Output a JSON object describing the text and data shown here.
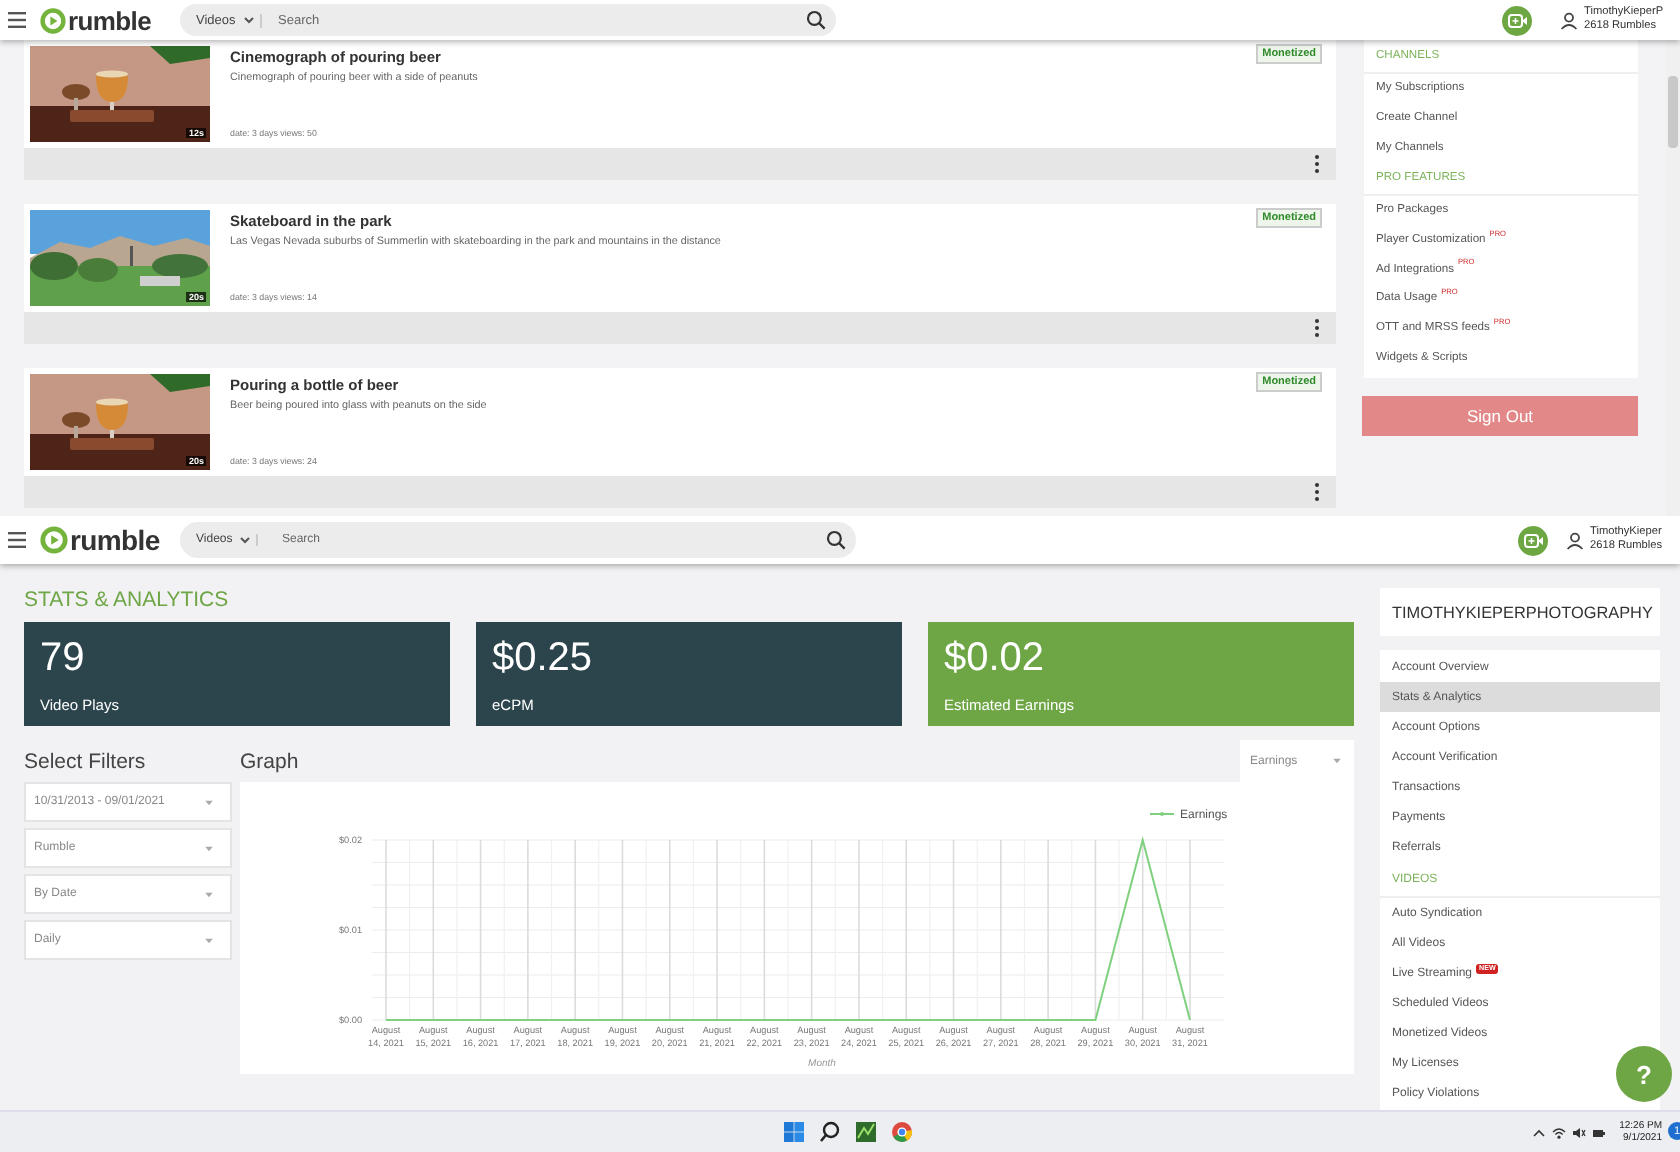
{
  "top_screen": {
    "header": {
      "logo": "rumble",
      "search_scope": "Videos",
      "search": {
        "placeholder": "Search"
      },
      "user": {
        "name": "TimothyKieperP",
        "rumbles": "2618 Rumbles"
      }
    },
    "videos": [
      {
        "title": "Cinemograph of pouring beer",
        "description": "Cinemograph of pouring beer with a side of peanuts",
        "meta": "date: 3 days views: 50",
        "duration": "12s",
        "status": "Monetized"
      },
      {
        "title": "Skateboard in the park",
        "description": "Las Vegas Nevada suburbs of Summerlin with skateboarding in the park and mountains in the distance",
        "meta": "date: 3 days views: 14",
        "duration": "20s",
        "status": "Monetized"
      },
      {
        "title": "Pouring a bottle of beer",
        "description": "Beer being poured into glass with peanuts on the side",
        "meta": "date: 3 days views: 24",
        "duration": "20s",
        "status": "Monetized"
      }
    ],
    "sidebar": [
      {
        "heading": "CHANNELS",
        "items": [
          {
            "label": "My Subscriptions"
          },
          {
            "label": "Create Channel"
          },
          {
            "label": "My Channels"
          }
        ]
      },
      {
        "heading": "PRO FEATURES",
        "items": [
          {
            "label": "Pro Packages"
          },
          {
            "label": "Player Customization",
            "tag": {
              "text": "PRO",
              "kind": "pro"
            }
          },
          {
            "label": "Ad Integrations",
            "tag": {
              "text": "PRO",
              "kind": "pro"
            }
          },
          {
            "label": "Data Usage",
            "tag": {
              "text": "PRO",
              "kind": "pro"
            }
          },
          {
            "label": "OTT and MRSS feeds",
            "tag": {
              "text": "PRO",
              "kind": "pro"
            }
          },
          {
            "label": "Widgets & Scripts"
          }
        ]
      }
    ],
    "sign_out": "Sign Out"
  },
  "bottom_screen": {
    "header": {
      "logo": "rumble",
      "search_scope": "Videos",
      "search": {
        "placeholder": "Search"
      },
      "user": {
        "name": "TimothyKieper",
        "rumbles": "2618 Rumbles"
      }
    },
    "title": "STATS & ANALYTICS",
    "stats": [
      {
        "value": "79",
        "label": "Video Plays",
        "color": "#2c454c"
      },
      {
        "value": "$0.25",
        "label": "eCPM",
        "color": "#2c454c"
      },
      {
        "value": "$0.02",
        "label": "Estimated Earnings",
        "color": "#6ea646"
      }
    ],
    "filters": {
      "heading": "Select Filters",
      "selects": [
        {
          "value": "10/31/2013 - 09/01/2021"
        },
        {
          "value": "Rumble"
        },
        {
          "value": "By Date"
        },
        {
          "value": "Daily"
        }
      ]
    },
    "graph": {
      "heading": "Graph",
      "metric": "Earnings",
      "chart_data": {
        "type": "line",
        "xlabel": "Month",
        "categories": [
          "August 14, 2021",
          "August 15, 2021",
          "August 16, 2021",
          "August 17, 2021",
          "August 18, 2021",
          "August 19, 2021",
          "August 20, 2021",
          "August 21, 2021",
          "August 22, 2021",
          "August 23, 2021",
          "August 24, 2021",
          "August 25, 2021",
          "August 26, 2021",
          "August 27, 2021",
          "August 28, 2021",
          "August 29, 2021",
          "August 30, 2021",
          "August 31, 2021"
        ],
        "series": [
          {
            "name": "Earnings",
            "color": "#7fd17f",
            "values": [
              0,
              0,
              0,
              0,
              0,
              0,
              0,
              0,
              0,
              0,
              0,
              0,
              0,
              0,
              0,
              0,
              0.02,
              0
            ]
          }
        ],
        "ylim": [
          0,
          0.02
        ],
        "grid": true,
        "yticks": [
          {
            "value": 0,
            "label": "$0.00"
          },
          {
            "value": 0.01,
            "label": "$0.01"
          },
          {
            "value": 0.02,
            "label": "$0.02"
          }
        ]
      }
    },
    "account": {
      "name": "TIMOTHYKIEPERPHOTOGRAPHY",
      "menu": [
        {
          "items": [
            {
              "label": "Account Overview",
              "selected": false
            },
            {
              "label": "Stats & Analytics",
              "selected": true
            },
            {
              "label": "Account Options",
              "selected": false
            },
            {
              "label": "Account Verification",
              "selected": false
            },
            {
              "label": "Transactions",
              "selected": false
            },
            {
              "label": "Payments",
              "selected": false
            },
            {
              "label": "Referrals",
              "selected": false
            }
          ]
        },
        {
          "heading": "VIDEOS",
          "items": [
            {
              "label": "Auto Syndication",
              "selected": false
            },
            {
              "label": "All Videos",
              "selected": false
            },
            {
              "label": "Live Streaming",
              "selected": false,
              "tag": {
                "text": "NEW",
                "kind": "new"
              }
            },
            {
              "label": "Scheduled Videos",
              "selected": false
            },
            {
              "label": "Monetized Videos",
              "selected": false
            },
            {
              "label": "My Licenses",
              "selected": false
            },
            {
              "label": "Policy Violations",
              "selected": false
            }
          ]
        }
      ]
    },
    "help": "?"
  },
  "taskbar": {
    "time": "12:26 PM",
    "date": "9/1/2021",
    "notifications": "1"
  }
}
